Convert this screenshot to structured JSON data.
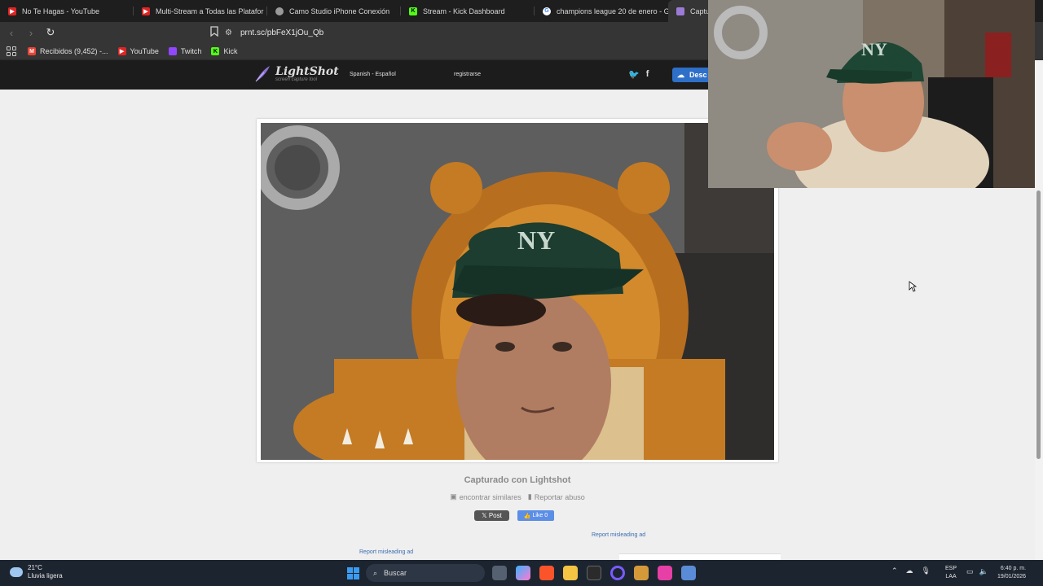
{
  "browser": {
    "tabs": [
      {
        "title": "No Te Hagas - YouTube",
        "favicon": "youtube-icon",
        "color": "#e02424"
      },
      {
        "title": "Multi-Stream a Todas las Platafor",
        "favicon": "youtube-icon",
        "color": "#e02424"
      },
      {
        "title": "Camo Studio iPhone Conexión",
        "favicon": "camo-icon",
        "color": "#9a9a9a"
      },
      {
        "title": "Stream - Kick Dashboard",
        "favicon": "kick-icon",
        "color": "#53fc18"
      },
      {
        "title": "champions league 20 de enero - Goo",
        "favicon": "google-icon",
        "color": "#ffffff"
      },
      {
        "title": "Captu",
        "favicon": "lightshot-icon",
        "color": "#9b7bd6"
      }
    ],
    "url": "prnt.sc/pbFeX1jOu_Qb",
    "bookmarks": [
      {
        "label": "Recibidos (9,452) -...",
        "icon": "gmail-icon",
        "color": "#ea4335"
      },
      {
        "label": "YouTube",
        "icon": "youtube-icon",
        "color": "#e02424"
      },
      {
        "label": "Twitch",
        "icon": "twitch-icon",
        "color": "#9146ff"
      },
      {
        "label": "Kick",
        "icon": "kick-icon",
        "color": "#53fc18"
      }
    ]
  },
  "site": {
    "logo_name": "LightShot",
    "logo_sub": "screen capture tool",
    "language": "Spanish - Español",
    "register": "registrarse",
    "download": "Desc",
    "captured_with": "Capturado con Lightshot",
    "find_similar": "encontrar similares",
    "report_abuse": "Reportar abuso",
    "x_post": "Post",
    "fb_like": "Like 0",
    "report_ad_1": "Report misleading ad",
    "report_ad_2": "Report misleading ad"
  },
  "taskbar": {
    "temperature": "21°C",
    "weather": "Lluvia ligera",
    "search": "Buscar",
    "lang_top": "ESP",
    "lang_bottom": "LAA",
    "time": "6:40 p. m.",
    "date": "19/01/2026"
  }
}
